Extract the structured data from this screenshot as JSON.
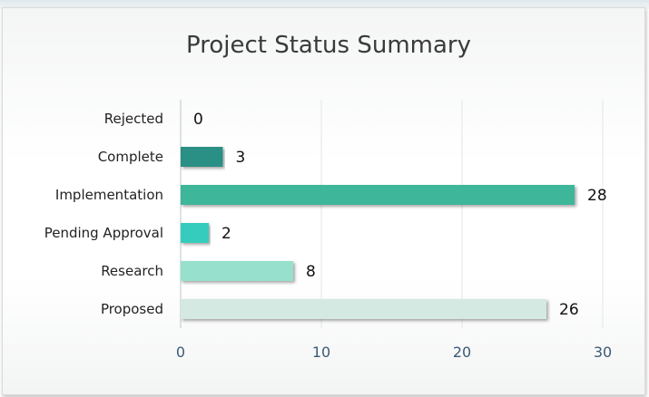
{
  "chart_data": {
    "type": "bar",
    "orientation": "horizontal",
    "title": "Project Status Summary",
    "xlabel": "",
    "ylabel": "",
    "categories": [
      "Rejected",
      "Complete",
      "Implementation",
      "Pending Approval",
      "Research",
      "Proposed"
    ],
    "values": [
      0,
      3,
      28,
      2,
      8,
      26
    ],
    "xlim": [
      0,
      30
    ],
    "x_ticks": [
      "0",
      "10",
      "20",
      "30"
    ],
    "grid": true,
    "legend": "none",
    "colors": [
      "#2a8f84",
      "#2a8f84",
      "#3db69a",
      "#35ccbd",
      "#96e0cd",
      "#d3e9e2"
    ]
  }
}
